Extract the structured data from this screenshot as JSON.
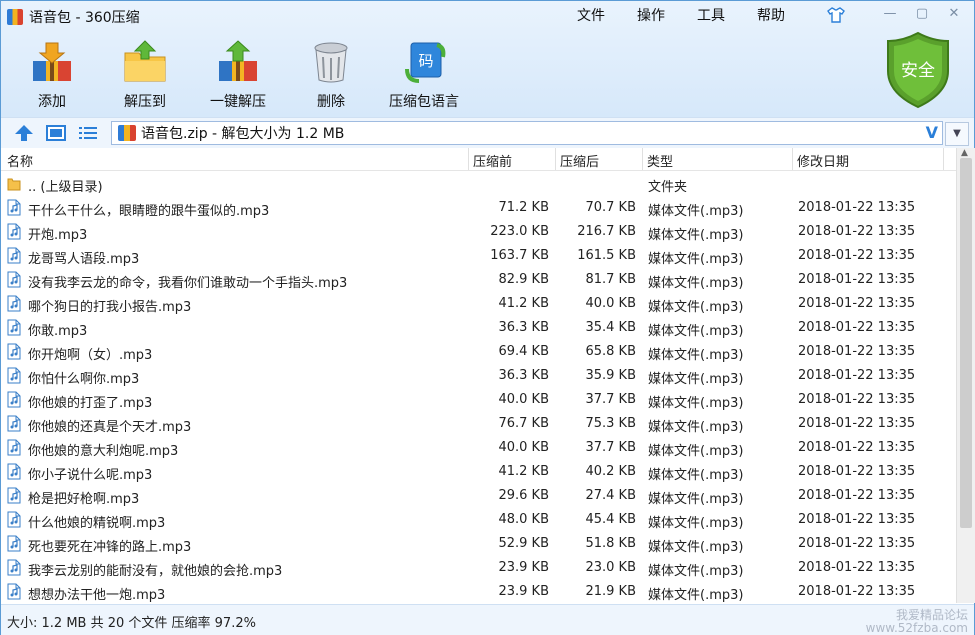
{
  "window": {
    "title": "语音包 - 360压缩"
  },
  "menu": [
    "文件",
    "操作",
    "工具",
    "帮助"
  ],
  "toolbar": [
    {
      "label": "添加",
      "icon": "add-archive-icon"
    },
    {
      "label": "解压到",
      "icon": "extract-to-icon"
    },
    {
      "label": "一键解压",
      "icon": "one-click-extract-icon"
    },
    {
      "label": "删除",
      "icon": "delete-trash-icon"
    },
    {
      "label": "压缩包语言",
      "icon": "archive-language-icon"
    }
  ],
  "toolbar_icon_text": "码",
  "security_badge": "安全",
  "path": {
    "text": "语音包.zip - 解包大小为 1.2 MB"
  },
  "columns": {
    "name": "名称",
    "packed": "压缩前",
    "unpacked": "压缩后",
    "type": "类型",
    "modified": "修改日期"
  },
  "parent_row": {
    "name": ".. (上级目录)",
    "type": "文件夹"
  },
  "files": [
    {
      "name": "干什么干什么，眼睛瞪的跟牛蛋似的.mp3",
      "packed": "71.2 KB",
      "unpacked": "70.7 KB",
      "type": "媒体文件(.mp3)",
      "modified": "2018-01-22 13:35"
    },
    {
      "name": "开炮.mp3",
      "packed": "223.0 KB",
      "unpacked": "216.7 KB",
      "type": "媒体文件(.mp3)",
      "modified": "2018-01-22 13:35"
    },
    {
      "name": "龙哥骂人语段.mp3",
      "packed": "163.7 KB",
      "unpacked": "161.5 KB",
      "type": "媒体文件(.mp3)",
      "modified": "2018-01-22 13:35"
    },
    {
      "name": "没有我李云龙的命令，我看你们谁敢动一个手指头.mp3",
      "packed": "82.9 KB",
      "unpacked": "81.7 KB",
      "type": "媒体文件(.mp3)",
      "modified": "2018-01-22 13:35"
    },
    {
      "name": "哪个狗日的打我小报告.mp3",
      "packed": "41.2 KB",
      "unpacked": "40.0 KB",
      "type": "媒体文件(.mp3)",
      "modified": "2018-01-22 13:35"
    },
    {
      "name": "你敢.mp3",
      "packed": "36.3 KB",
      "unpacked": "35.4 KB",
      "type": "媒体文件(.mp3)",
      "modified": "2018-01-22 13:35"
    },
    {
      "name": "你开炮啊（女）.mp3",
      "packed": "69.4 KB",
      "unpacked": "65.8 KB",
      "type": "媒体文件(.mp3)",
      "modified": "2018-01-22 13:35"
    },
    {
      "name": "你怕什么啊你.mp3",
      "packed": "36.3 KB",
      "unpacked": "35.9 KB",
      "type": "媒体文件(.mp3)",
      "modified": "2018-01-22 13:35"
    },
    {
      "name": "你他娘的打歪了.mp3",
      "packed": "40.0 KB",
      "unpacked": "37.7 KB",
      "type": "媒体文件(.mp3)",
      "modified": "2018-01-22 13:35"
    },
    {
      "name": "你他娘的还真是个天才.mp3",
      "packed": "76.7 KB",
      "unpacked": "75.3 KB",
      "type": "媒体文件(.mp3)",
      "modified": "2018-01-22 13:35"
    },
    {
      "name": "你他娘的意大利炮呢.mp3",
      "packed": "40.0 KB",
      "unpacked": "37.7 KB",
      "type": "媒体文件(.mp3)",
      "modified": "2018-01-22 13:35"
    },
    {
      "name": "你小子说什么呢.mp3",
      "packed": "41.2 KB",
      "unpacked": "40.2 KB",
      "type": "媒体文件(.mp3)",
      "modified": "2018-01-22 13:35"
    },
    {
      "name": "枪是把好枪啊.mp3",
      "packed": "29.6 KB",
      "unpacked": "27.4 KB",
      "type": "媒体文件(.mp3)",
      "modified": "2018-01-22 13:35"
    },
    {
      "name": "什么他娘的精锐啊.mp3",
      "packed": "48.0 KB",
      "unpacked": "45.4 KB",
      "type": "媒体文件(.mp3)",
      "modified": "2018-01-22 13:35"
    },
    {
      "name": "死也要死在冲锋的路上.mp3",
      "packed": "52.9 KB",
      "unpacked": "51.8 KB",
      "type": "媒体文件(.mp3)",
      "modified": "2018-01-22 13:35"
    },
    {
      "name": "我李云龙别的能耐没有，就他娘的会抢.mp3",
      "packed": "23.9 KB",
      "unpacked": "23.0 KB",
      "type": "媒体文件(.mp3)",
      "modified": "2018-01-22 13:35"
    },
    {
      "name": "想想办法干他一炮.mp3",
      "packed": "23.9 KB",
      "unpacked": "21.9 KB",
      "type": "媒体文件(.mp3)",
      "modified": "2018-01-22 13:35"
    }
  ],
  "status": {
    "text": "大小: 1.2 MB 共 20 个文件 压缩率 97.2%"
  },
  "watermark": {
    "line1": "我爱精品论坛",
    "line2": "www.52fzba.com"
  },
  "colors": {
    "accent": "#2b7fd8",
    "shield": "#5aa02c"
  }
}
